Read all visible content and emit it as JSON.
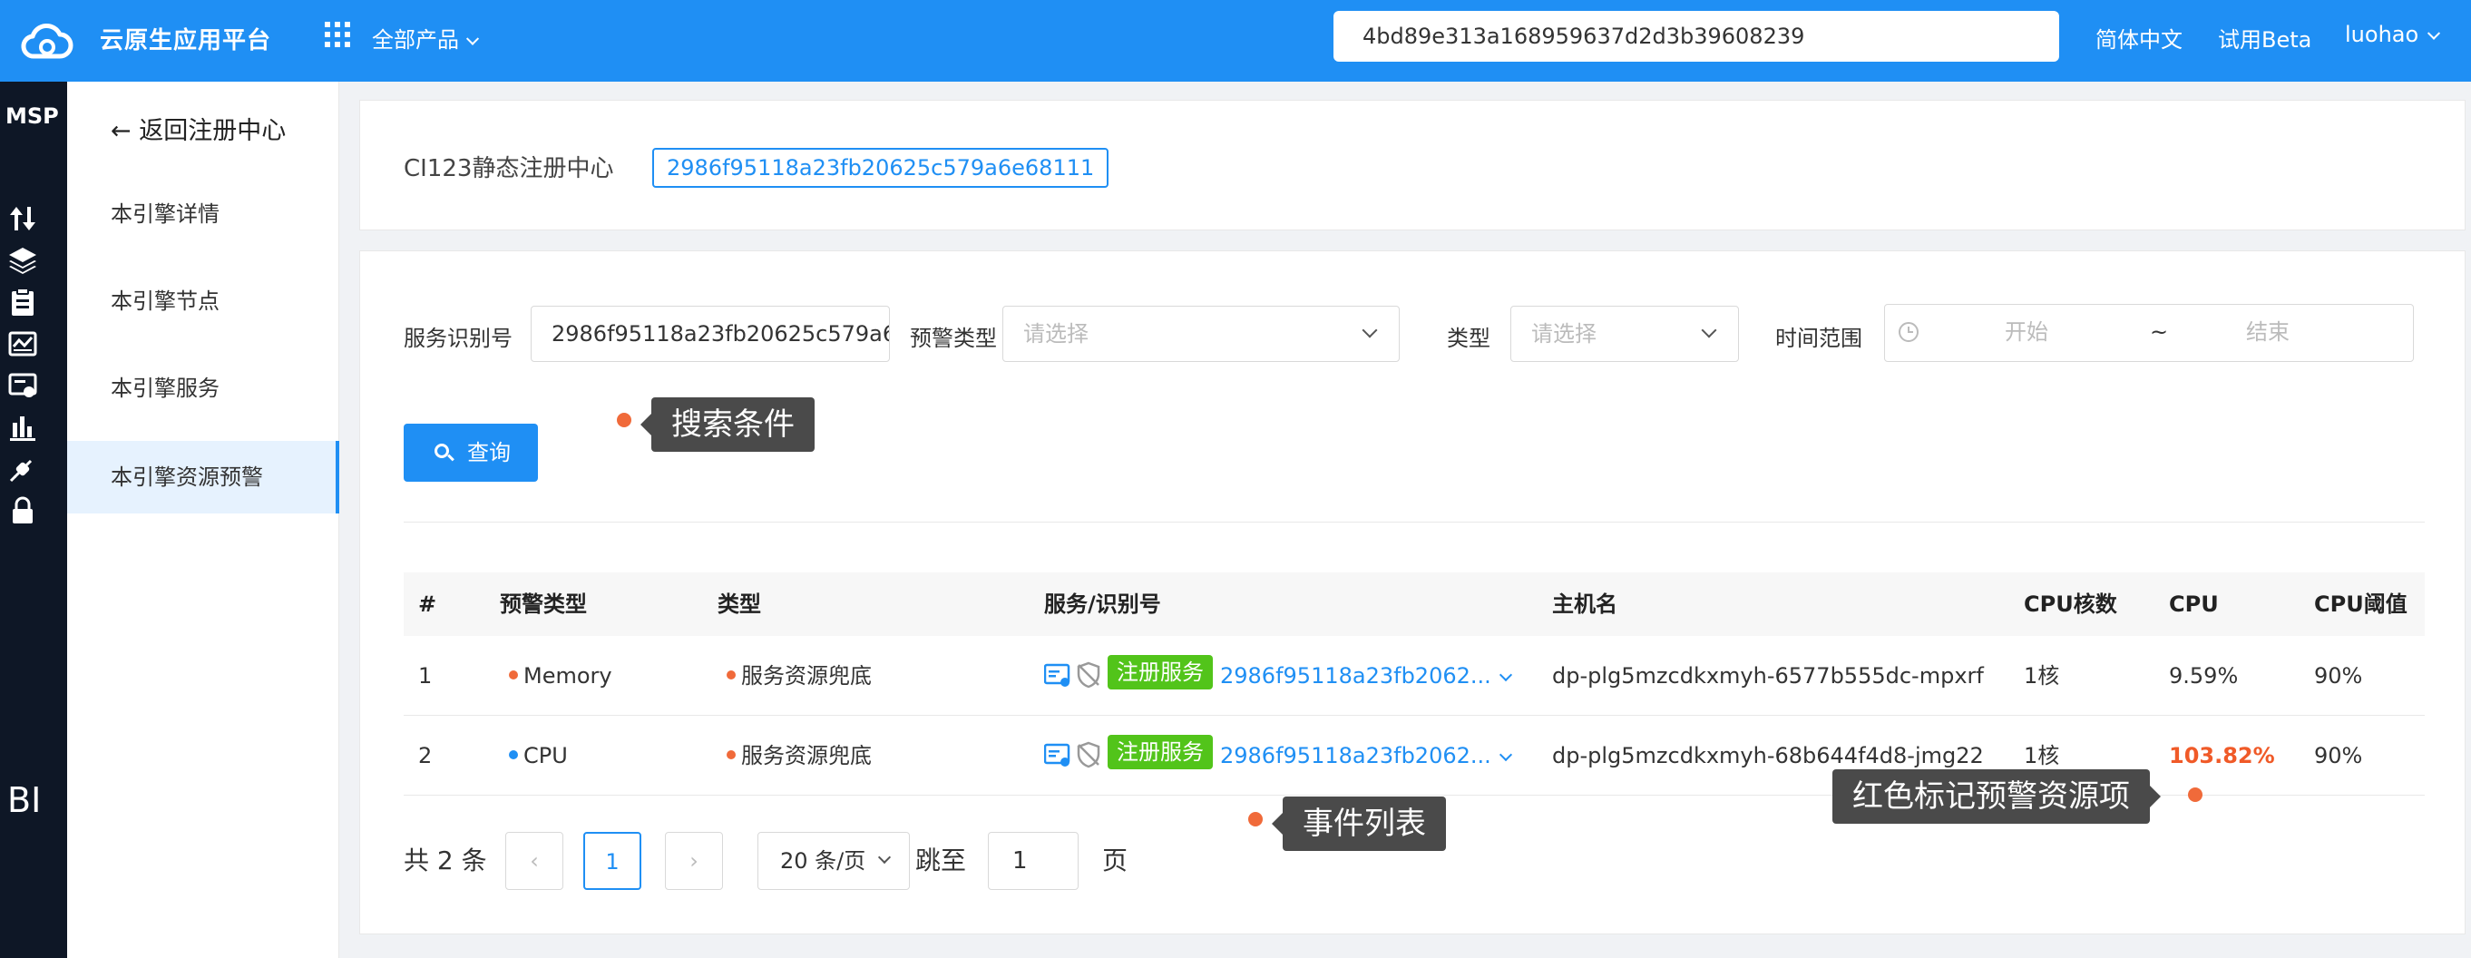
{
  "topbar": {
    "brand": "云原生应用平台",
    "products_label": "全部产品",
    "search_value": "4bd89e313a168959637d2d3b39608239",
    "language": "简体中文",
    "beta": "试用Beta",
    "user": "luohao"
  },
  "rail": {
    "msp": "MSP",
    "bi": "BI"
  },
  "sidebar": {
    "back_label": "返回注册中心",
    "items": [
      {
        "label": "本引擎详情"
      },
      {
        "label": "本引擎节点"
      },
      {
        "label": "本引擎服务"
      },
      {
        "label": "本引擎资源预警"
      }
    ]
  },
  "registry": {
    "name": "CI123静态注册中心",
    "id": "2986f95118a23fb20625c579a6e68111"
  },
  "filters": {
    "service_id_label": "服务识别号",
    "service_id_value": "2986f95118a23fb20625c579a6e68111",
    "alert_type_label": "预警类型",
    "alert_type_placeholder": "请选择",
    "type_label": "类型",
    "type_placeholder": "请选择",
    "time_label": "时间范围",
    "time_start": "开始",
    "time_sep": "~",
    "time_end": "结束",
    "query_label": "查询"
  },
  "table": {
    "headers": [
      "#",
      "预警类型",
      "类型",
      "服务/识别号",
      "主机名",
      "CPU核数",
      "CPU",
      "CPU阈值"
    ],
    "rows": [
      {
        "index": "1",
        "alert_type": "Memory",
        "type": "服务资源兜底",
        "service_tag": "注册服务",
        "service_id": "2986f95118a23fb2062...",
        "hostname": "dp-plg5mzcdkxmyh-6577b555dc-mpxrf",
        "cores": "1核",
        "cpu": "9.59%",
        "threshold": "90%"
      },
      {
        "index": "2",
        "alert_type": "CPU",
        "type": "服务资源兜底",
        "service_tag": "注册服务",
        "service_id": "2986f95118a23fb2062...",
        "hostname": "dp-plg5mzcdkxmyh-68b644f4d8-jmg22",
        "cores": "1核",
        "cpu": "103.82%",
        "threshold": "90%"
      }
    ]
  },
  "pagination": {
    "total": "共 2 条",
    "prev": "‹",
    "current": "1",
    "next": "›",
    "page_size": "20 条/页",
    "jump_label": "跳至",
    "jump_value": "1",
    "page_unit": "页"
  },
  "annotations": {
    "search_conditions": "搜索条件",
    "event_list": "事件列表",
    "red_marked": "红色标记预警资源项"
  },
  "colors": {
    "primary": "#1f8ff4",
    "rail": "#0e1726",
    "tag_green": "#52c41a",
    "alert_red": "#f05a28",
    "dot_orange": "#f06a3a"
  }
}
